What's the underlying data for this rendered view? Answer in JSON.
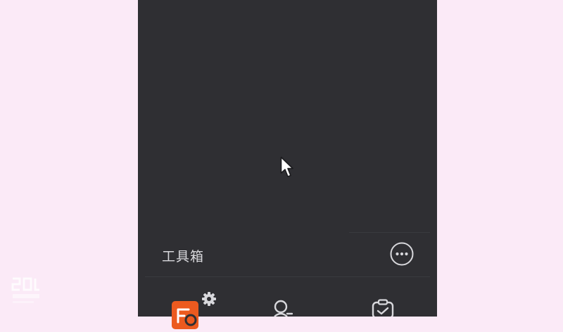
{
  "toolbox": {
    "title": "工具箱",
    "more_icon": "more-horizontal-icon"
  },
  "tools": [
    {
      "icon": "app-settings-icon",
      "accent": "#ec5a1f"
    },
    {
      "icon": "user-add-icon"
    },
    {
      "icon": "task-check-icon"
    }
  ],
  "colors": {
    "panel_bg": "#2f2f33",
    "page_bg": "#fbeaf7",
    "text": "#d8d8dc",
    "accent": "#ec5a1f"
  }
}
